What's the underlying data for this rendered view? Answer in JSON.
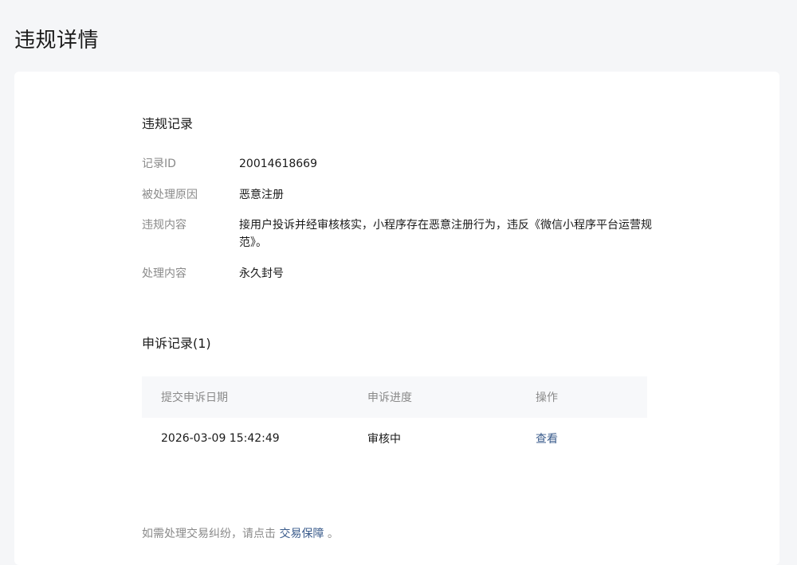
{
  "page": {
    "title": "违规详情"
  },
  "record": {
    "section_title": "违规记录",
    "fields": [
      {
        "label": "记录ID",
        "value": "20014618669"
      },
      {
        "label": "被处理原因",
        "value": "恶意注册"
      },
      {
        "label": "违规内容",
        "value": "接用户投诉并经审核核实，小程序存在恶意注册行为，违反《微信小程序平台运营规范》。"
      },
      {
        "label": "处理内容",
        "value": "永久封号"
      }
    ]
  },
  "appeal": {
    "section_title": "申诉记录(1)",
    "columns": [
      "提交申诉日期",
      "申诉进度",
      "操作"
    ],
    "rows": [
      {
        "date": "2026-03-09 15:42:49",
        "status": "审核中",
        "action": "查看"
      }
    ]
  },
  "footer": {
    "prefix": "如需处理交易纠纷，请点击",
    "link": "交易保障",
    "suffix": "。"
  }
}
